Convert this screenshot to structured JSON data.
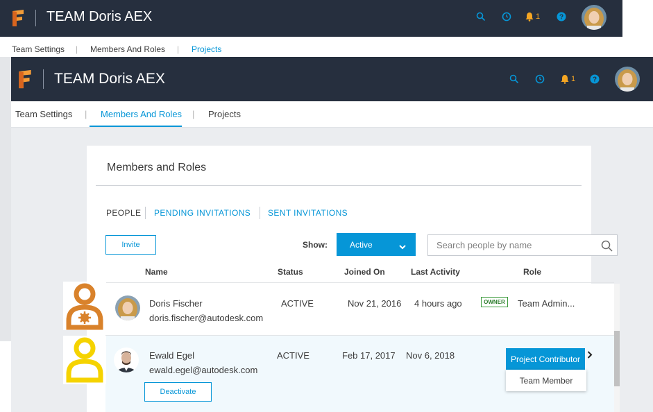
{
  "app": {
    "team_title": "TEAM Doris AEX",
    "notification_count": "1"
  },
  "nav_tabs": [
    "Team Settings",
    "Members And Roles",
    "Projects"
  ],
  "nav_sep": "|",
  "card": {
    "title": "Members and Roles",
    "sub_tabs": [
      "PEOPLE",
      "PENDING INVITATIONS",
      "SENT INVITATIONS"
    ],
    "invite_label": "Invite",
    "show_label": "Show:",
    "show_value": "Active",
    "search_placeholder": "Search people by name",
    "columns": [
      "Name",
      "Status",
      "Joined On",
      "Last Activity",
      "Role"
    ]
  },
  "members": [
    {
      "name": "Doris Fischer",
      "email": "doris.fischer@autodesk.com",
      "status": "ACTIVE",
      "joined": "Nov 21, 2016",
      "last_activity": "4 hours ago",
      "badge": "OWNER",
      "role": "Team Admin..."
    },
    {
      "name": "Ewald Egel",
      "email": "ewald.egel@autodesk.com",
      "status": "ACTIVE",
      "joined": "Feb 17, 2017",
      "last_activity": "Nov 6, 2018",
      "role_selected": "Project Contributor",
      "role_option": "Team Member",
      "action": "Deactivate"
    }
  ],
  "colors": {
    "header_bg": "#262f3e",
    "accent": "#0696d7",
    "notification": "#f5a623",
    "owner_badge": "#3c9b3c",
    "admin_icon": "#d9822b",
    "member_icon": "#f5d300"
  },
  "icons": [
    "logo-f-icon",
    "search-icon",
    "clock-icon",
    "bell-icon",
    "help-icon",
    "chevron-down-icon",
    "chevron-right-icon",
    "admin-person-icon",
    "member-person-icon"
  ]
}
